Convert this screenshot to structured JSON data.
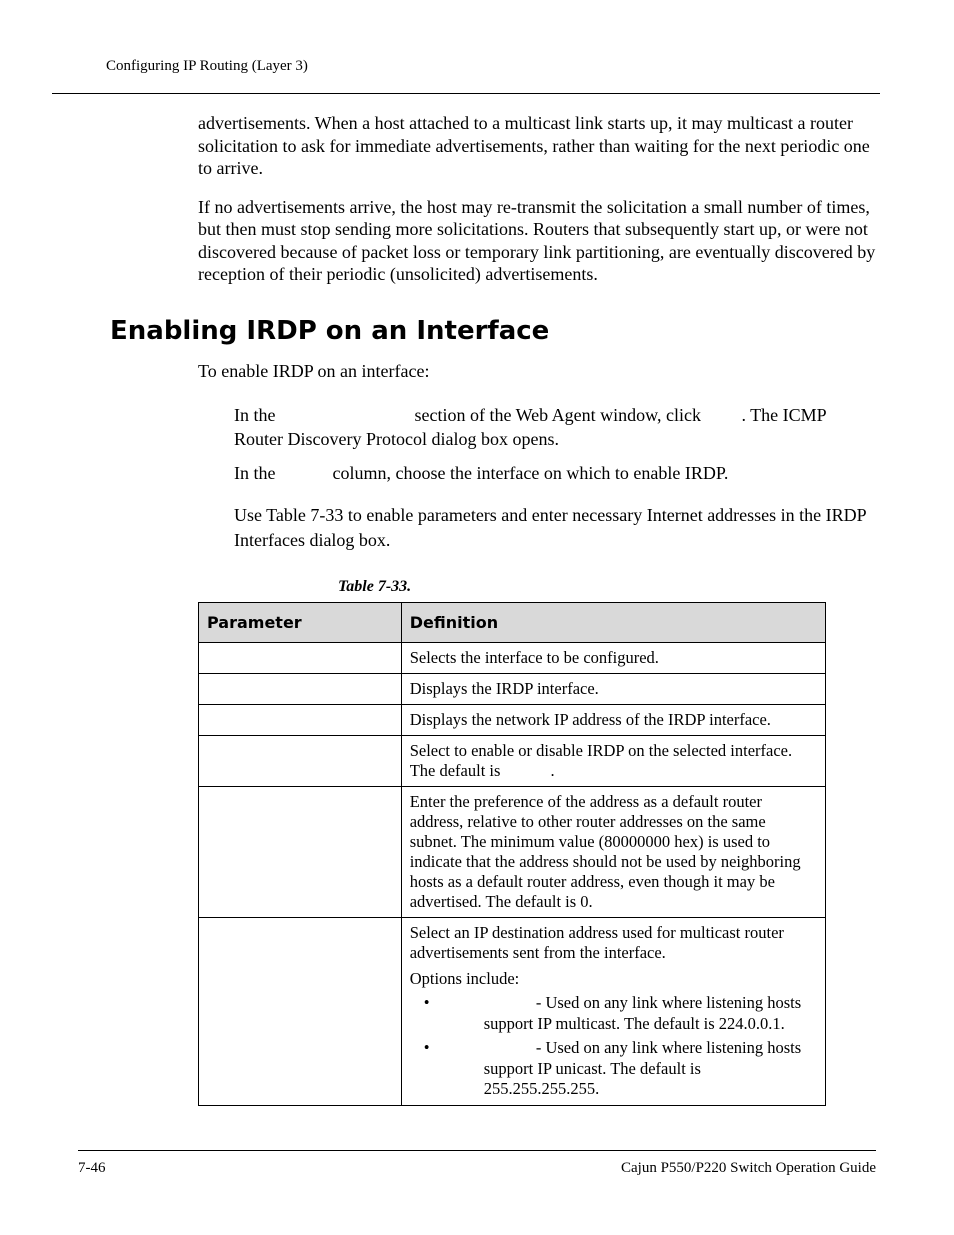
{
  "header": {
    "running": "Configuring IP Routing (Layer 3)"
  },
  "body": {
    "p1": "advertisements. When a host attached to a multicast link starts up, it may multicast a router solicitation to ask for immediate advertisements, rather than waiting for the next periodic one to arrive.",
    "p2": "If no advertisements arrive, the host may re-transmit the solicitation a small number of times, but then must stop sending more solicitations. Routers that subsequently start up, or were not discovered because of packet loss or temporary link partitioning, are eventually discovered by reception of their periodic (unsolicited) advertisements."
  },
  "section": {
    "title": "Enabling IRDP on an Interface",
    "intro": "To enable IRDP on an interface:",
    "step1a": "In the ",
    "step1b": " section of the Web Agent window, click ",
    "step1c": ". The ICMP Router Discovery Protocol dialog box opens.",
    "step2a": "In the ",
    "step2b": " column, choose the interface on which to enable IRDP.",
    "step3": "Use Table 7-33 to enable parameters and enter necessary Internet addresses in the IRDP Interfaces dialog box."
  },
  "table": {
    "caption": "Table 7-33.",
    "head": {
      "c1": "Parameter",
      "c2": "Definition"
    },
    "rows": [
      {
        "c1": "",
        "c2": "Selects the interface to be configured."
      },
      {
        "c1": "",
        "c2": "Displays the IRDP interface."
      },
      {
        "c1": "",
        "c2": "Displays the network IP address of the IRDP interface."
      },
      {
        "c1": "",
        "c2_a": "Select to enable or disable IRDP on the selected interface. The default is ",
        "c2_b": "."
      },
      {
        "c1": "",
        "c2": "Enter the preference of the address as a default router address, relative to other router addresses on the same subnet. The minimum value (80000000 hex) is used to indicate that the address should not be used by neighboring hosts as a default router address, even though it may be advertised. The default is 0."
      },
      {
        "c1": "",
        "c2_top": "Select an IP destination address used for multicast router advertisements sent from the interface.",
        "c2_opts_label": "Options include:",
        "opts": [
          " - Used on any link where listening hosts support IP multicast. The default is 224.0.0.1.",
          " - Used on any link where listening hosts support IP unicast. The default is 255.255.255.255."
        ]
      }
    ]
  },
  "footer": {
    "left": "7-46",
    "right": "Cajun P550/P220 Switch Operation Guide"
  }
}
